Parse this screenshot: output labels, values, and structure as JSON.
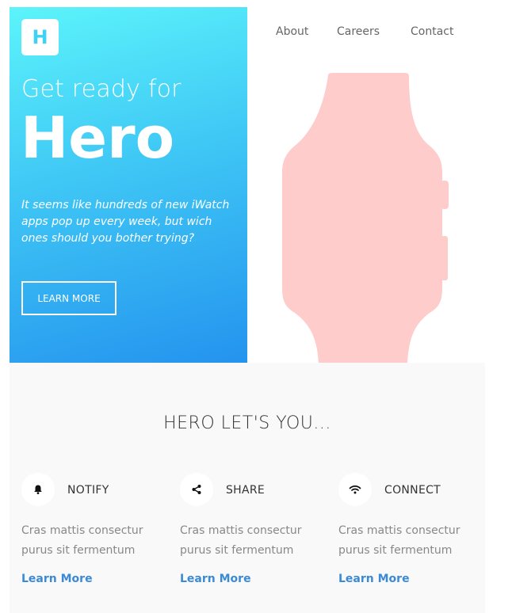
{
  "logo": {
    "letter": "H"
  },
  "nav": {
    "items": [
      {
        "label": "About"
      },
      {
        "label": "Careers"
      },
      {
        "label": "Contact"
      }
    ]
  },
  "hero": {
    "pretitle": "Get ready for",
    "title": "Hero",
    "description": "It seems like hundreds of new iWatch apps pop up every week, but wich ones should you bother trying?",
    "button_label": "LEARN MORE",
    "gradient_colors": [
      "#5cf4fb",
      "#2493ee"
    ]
  },
  "watch": {
    "color": "#ffcccc"
  },
  "features": {
    "title": "HERO LET'S YOU...",
    "items": [
      {
        "icon": "bell-icon",
        "label": "NOTIFY",
        "text": "Cras mattis consectur purus sit fermentum",
        "link": "Learn More"
      },
      {
        "icon": "share-icon",
        "label": "SHARE",
        "text": "Cras mattis consectur purus sit fermentum",
        "link": "Learn More"
      },
      {
        "icon": "wifi-icon",
        "label": "CONNECT",
        "text": "Cras mattis consectur purus sit fermentum",
        "link": "Learn More"
      }
    ],
    "link_color": "#3b8ad6"
  }
}
